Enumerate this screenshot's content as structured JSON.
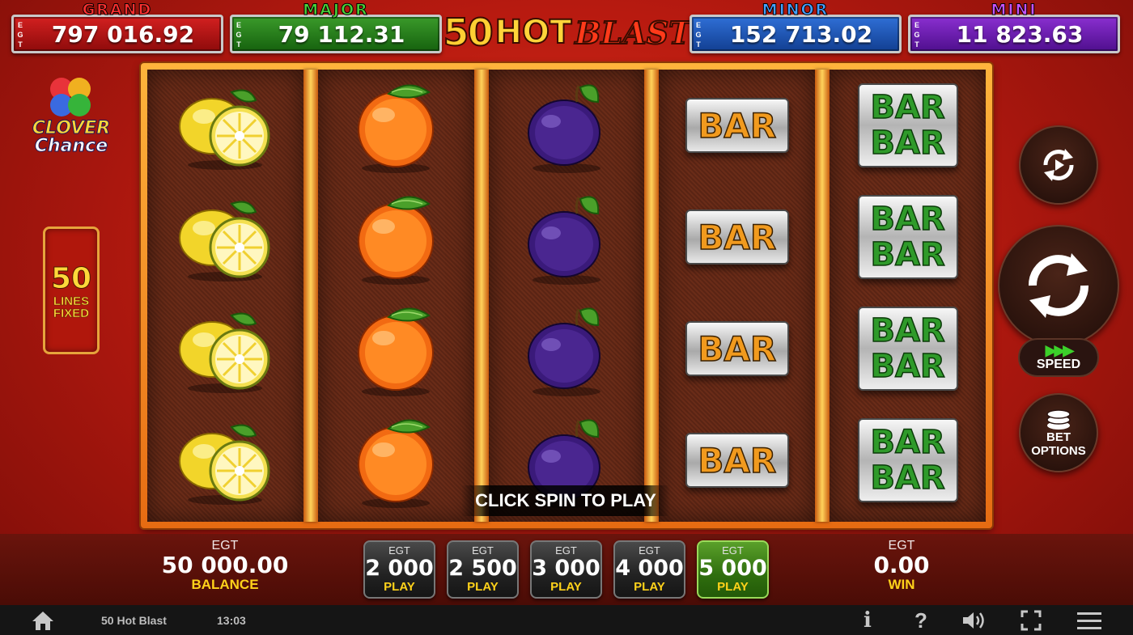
{
  "jackpots": {
    "grand": {
      "name": "GRAND",
      "currency": "EGT",
      "value": "797 016.92"
    },
    "major": {
      "name": "MAJOR",
      "currency": "EGT",
      "value": "79 112.31"
    },
    "minor": {
      "name": "MINOR",
      "currency": "EGT",
      "value": "152 713.02"
    },
    "mini": {
      "name": "MINI",
      "currency": "EGT",
      "value": "11 823.63"
    }
  },
  "logo": {
    "number": "50",
    "hot": "HOT",
    "blast": "BLAST"
  },
  "clover": {
    "line1": "CLOVER",
    "line2": "Chance"
  },
  "lines": {
    "count": "50",
    "line1": "LINES",
    "line2": "FIXED"
  },
  "reels": [
    [
      "lemon",
      "lemon",
      "lemon",
      "lemon"
    ],
    [
      "orange",
      "orange",
      "orange",
      "orange"
    ],
    [
      "plum",
      "plum",
      "plum",
      "plum"
    ],
    [
      "bar",
      "bar",
      "bar",
      "bar"
    ],
    [
      "double-bar",
      "double-bar",
      "double-bar",
      "double-bar"
    ]
  ],
  "symbols": {
    "bar_text": "BAR"
  },
  "message": "CLICK SPIN TO PLAY",
  "controls": {
    "speed_label": "SPEED",
    "bet_options_line1": "BET",
    "bet_options_line2": "OPTIONS"
  },
  "balance": {
    "currency": "EGT",
    "value": "50 000.00",
    "label": "BALANCE"
  },
  "win": {
    "currency": "EGT",
    "value": "0.00",
    "label": "WIN"
  },
  "bets": [
    {
      "currency": "EGT",
      "value": "2 000",
      "label": "PLAY",
      "selected": false
    },
    {
      "currency": "EGT",
      "value": "2 500",
      "label": "PLAY",
      "selected": false
    },
    {
      "currency": "EGT",
      "value": "3 000",
      "label": "PLAY",
      "selected": false
    },
    {
      "currency": "EGT",
      "value": "4 000",
      "label": "PLAY",
      "selected": false
    },
    {
      "currency": "EGT",
      "value": "5 000",
      "label": "PLAY",
      "selected": true
    }
  ],
  "status_bar": {
    "game_name": "50 Hot Blast",
    "time": "13:03",
    "info": "i",
    "help": "?"
  },
  "colors": {
    "accent": "#ffd21a",
    "selected_bet": "#2f6e0e",
    "background": "#b81a10"
  }
}
